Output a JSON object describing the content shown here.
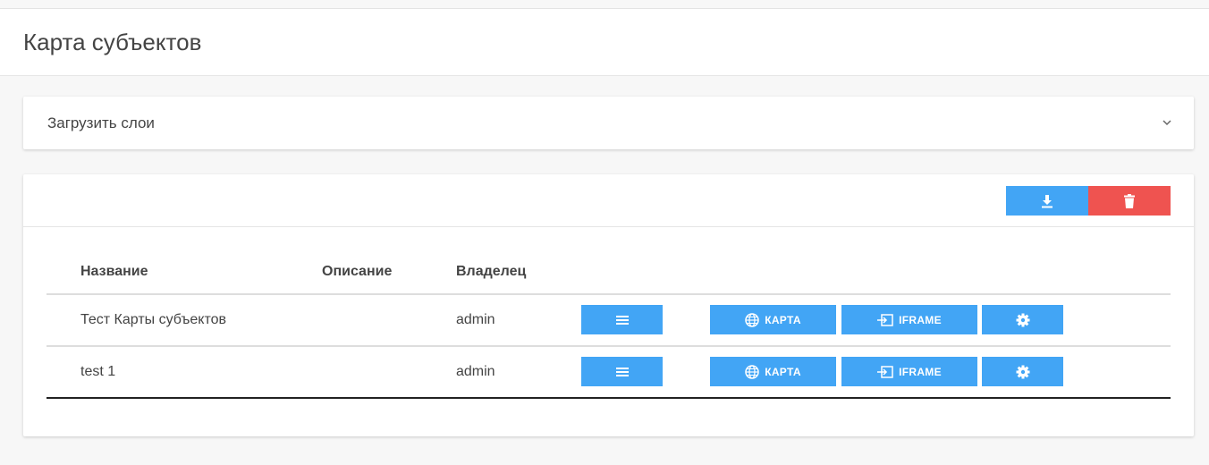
{
  "page": {
    "title": "Карта субъектов"
  },
  "accordion": {
    "title": "Загрузить слои",
    "icon": "chevron-down-icon"
  },
  "toolbar": {
    "download_icon": "download-icon",
    "delete_icon": "trash-icon",
    "colors": {
      "primary": "#42a5f5",
      "danger": "#ef5350"
    }
  },
  "table": {
    "columns": [
      "Название",
      "Описание",
      "Владелец"
    ],
    "rows": [
      {
        "name": "Тест Карты субъектов",
        "description": "",
        "owner": "admin",
        "buttons": {
          "map": "КАРТА",
          "iframe": "IFRAME"
        }
      },
      {
        "name": "test 1",
        "description": "",
        "owner": "admin",
        "buttons": {
          "map": "КАРТА",
          "iframe": "IFRAME"
        }
      }
    ]
  }
}
